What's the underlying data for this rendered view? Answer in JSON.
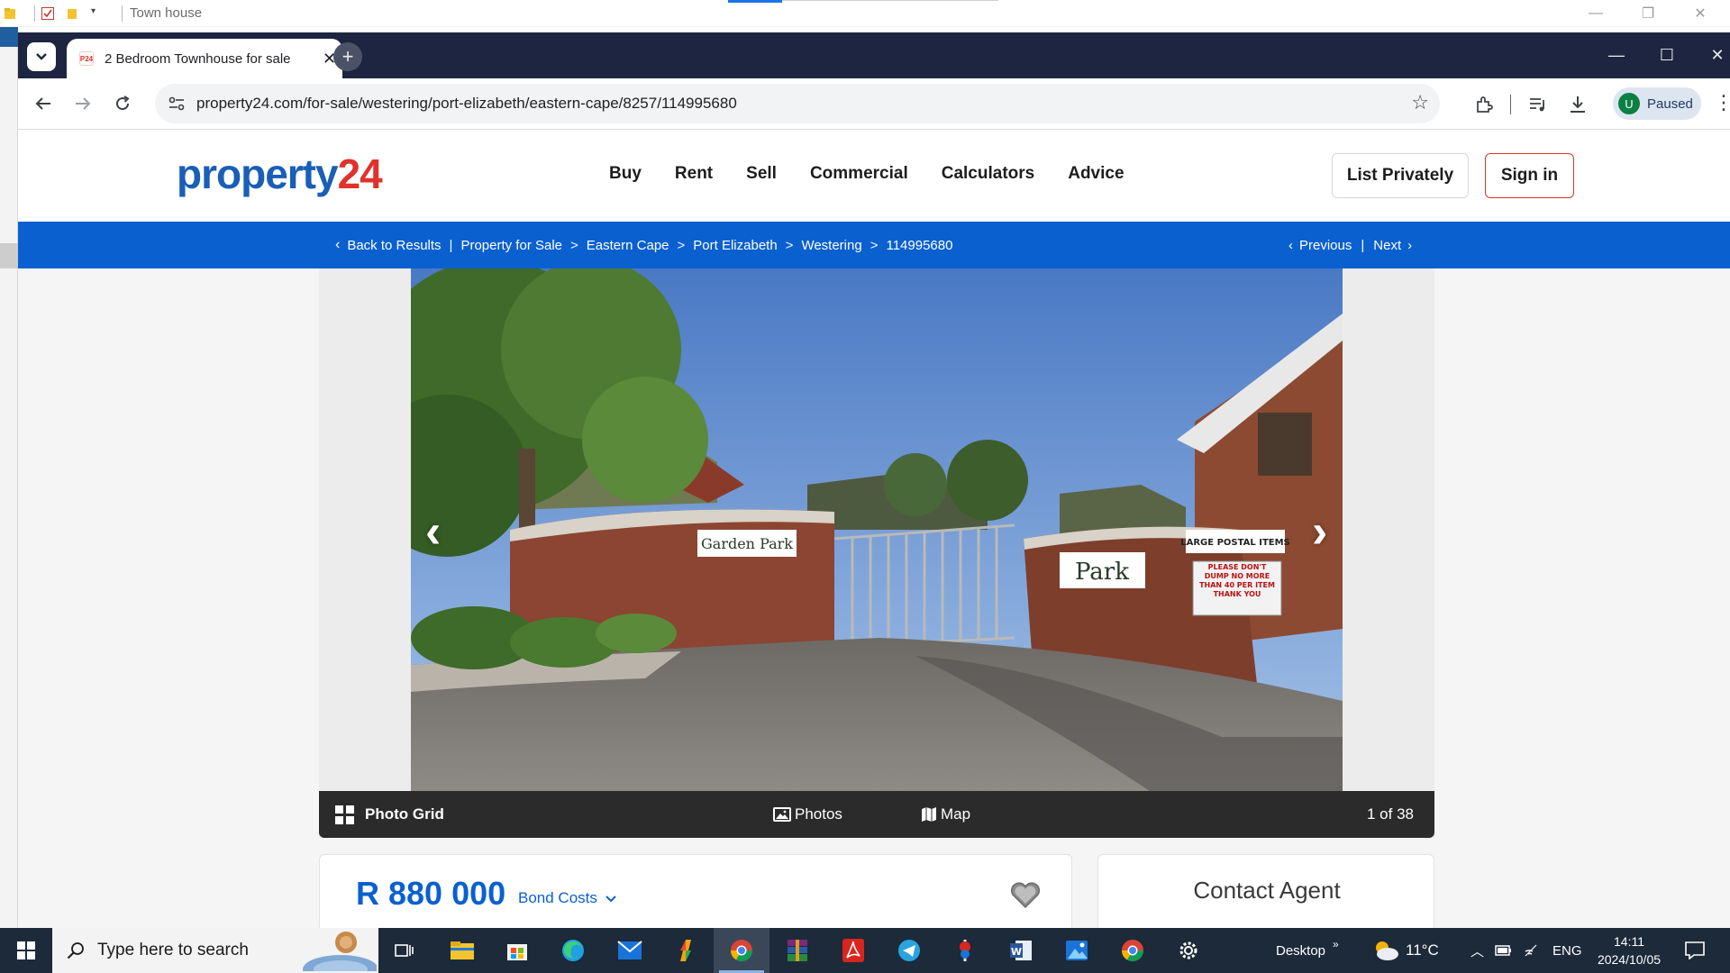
{
  "explorer": {
    "title": "Town house"
  },
  "browser": {
    "tab_title": "2 Bedroom Townhouse for sale",
    "tab_favicon": "P24",
    "url": "property24.com/for-sale/westering/port-elizabeth/eastern-cape/8257/114995680",
    "profile_initial": "U",
    "profile_label": "Paused"
  },
  "site": {
    "logo_part1": "property",
    "logo_part2": "24",
    "nav": [
      "Buy",
      "Rent",
      "Sell",
      "Commercial",
      "Calculators",
      "Advice"
    ],
    "list_privately": "List Privately",
    "sign_in": "Sign in",
    "brand_blue": "#0b60d0",
    "brand_red": "#e0322c"
  },
  "breadcrumb": {
    "back": "Back to Results",
    "items": [
      "Property for Sale",
      "Eastern Cape",
      "Port Elizabeth",
      "Westering",
      "114995680"
    ],
    "previous": "Previous",
    "next": "Next"
  },
  "gallery": {
    "photo_grid": "Photo Grid",
    "photos": "Photos",
    "map": "Map",
    "counter": "1 of 38",
    "sign_left": "Garden Park",
    "sign_right": "Park",
    "notice_title": "LARGE POSTAL ITEMS",
    "notice_body": "PLEASE DON'T DUMP NO MORE THAN 40 PER ITEM THANK YOU"
  },
  "listing": {
    "price": "R 880 000",
    "bond_costs": "Bond Costs",
    "contact_agent": "Contact Agent"
  },
  "taskbar": {
    "search_placeholder": "Type here to search",
    "desktop_label": "Desktop",
    "temperature": "11°C",
    "language": "ENG",
    "time": "14:11",
    "date": "2024/10/05"
  }
}
